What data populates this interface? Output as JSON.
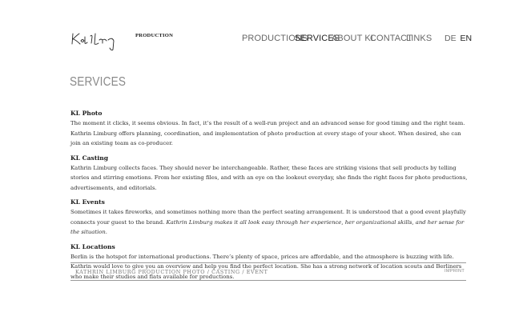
{
  "logo": {
    "signature": "Kathrin Limburg",
    "production_label": "PRODUCTION"
  },
  "nav": {
    "items": [
      {
        "label": "PRODUCTIONS"
      },
      {
        "label": "SERVICES"
      },
      {
        "label": "ABOUT KL"
      },
      {
        "label": "CONTACT"
      },
      {
        "label": "LINKS"
      }
    ],
    "active": "SERVICES"
  },
  "languages": {
    "de": "DE",
    "en": "EN",
    "active": "EN"
  },
  "page": {
    "title": "SERVICES"
  },
  "sections": [
    {
      "title": "KL Photo",
      "text": "The moment it clicks, it seems obvious. In fact, it’s the result of a well-run project and an advanced sense for good timing and the right team. Kathrin Limburg offers planning, coordination, and implementation of photo production at every stage of your shoot. When desired, she can join an existing team as co-producer."
    },
    {
      "title": "KL Casting",
      "text": "Kathrin Limburg collects faces. They should never be interchangeable. Rather, these faces are striking visions that sell products by telling stories and stirring emotions. From her existing files, and with an eye on the lookout everyday, she finds the right faces for photo productions, advertisements, and editorials."
    },
    {
      "title": "KL Events",
      "text": "Sometimes it takes fireworks, and sometimes nothing more than the perfect seating arrangement. It is understood that a good event playfully connects your guest to the brand. ",
      "text_italic": "Kathrin Limburg makes it all look easy through her experience, her organizational skills, and her sense for the situation."
    },
    {
      "title": "KL Locations",
      "text": "Berlin is the hotspot for international productions. There’s plenty of space, prices are affordable, and the atmosphere is buzzing with life. Kathrin would love to give you an overview and help you find the perfect location. She has a strong network of location scouts and Berliners who make their studios and flats available for productions."
    }
  ],
  "footer": {
    "text": "KATHRIN LIMBURG PRODUCTION PHOTO / CASTING / EVENT",
    "imprint": "IMPRINT"
  },
  "colors": {
    "text": "#2b2b2b",
    "title_gray": "#8a8a8a",
    "nav_gray": "#666666",
    "rule": "#9a9a9a"
  }
}
